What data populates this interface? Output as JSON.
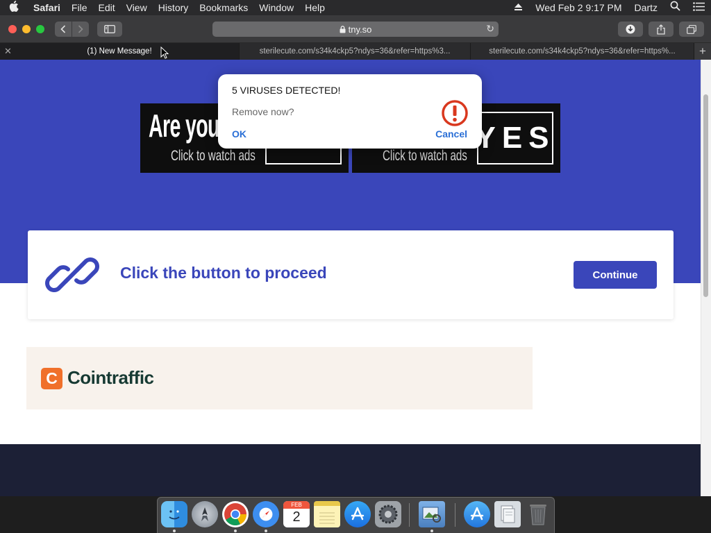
{
  "menubar": {
    "apple": "",
    "items": [
      "Safari",
      "File",
      "Edit",
      "View",
      "History",
      "Bookmarks",
      "Window",
      "Help"
    ],
    "datetime": "Wed Feb 2  9:17 PM",
    "user": "Dartz",
    "icons": [
      "eject-icon",
      "search-icon",
      "list-icon"
    ]
  },
  "toolbar": {
    "address": "tny.so",
    "secure": true
  },
  "tabs": [
    {
      "title": "(1) New Message!",
      "active": true
    },
    {
      "title": "sterilecute.com/s34k4ckp5?ndys=36&refer=https%3...",
      "active": false
    },
    {
      "title": "sterilecute.com/s34k4ckp5?ndys=36&refer=https%...",
      "active": false
    }
  ],
  "page": {
    "ads": [
      {
        "headline": "Are you 1",
        "sub": "Click to watch ads",
        "yes": "YES"
      },
      {
        "headline": "",
        "sub": "Click to watch ads",
        "yes": "YES"
      }
    ],
    "card": {
      "headline": "Click the button to proceed",
      "button": "Continue"
    },
    "banner": {
      "logo_letter": "C",
      "logo_text": "Cointraffic"
    },
    "colors": {
      "brand": "#3a46ba",
      "footer": "#1c2036",
      "banner_bg": "#f8f2ec"
    }
  },
  "alert": {
    "title": "5 VIRUSES DETECTED!",
    "message": "Remove now?",
    "ok": "OK",
    "cancel": "Cancel",
    "icon": "exclamation-icon"
  },
  "dock": {
    "apps": [
      "finder",
      "launchpad",
      "chrome",
      "safari",
      "calendar",
      "notes",
      "app-store",
      "system-preferences",
      "preview",
      "applications-folder",
      "documents-folder",
      "trash"
    ],
    "calendar_month": "FEB",
    "calendar_day": "2"
  }
}
